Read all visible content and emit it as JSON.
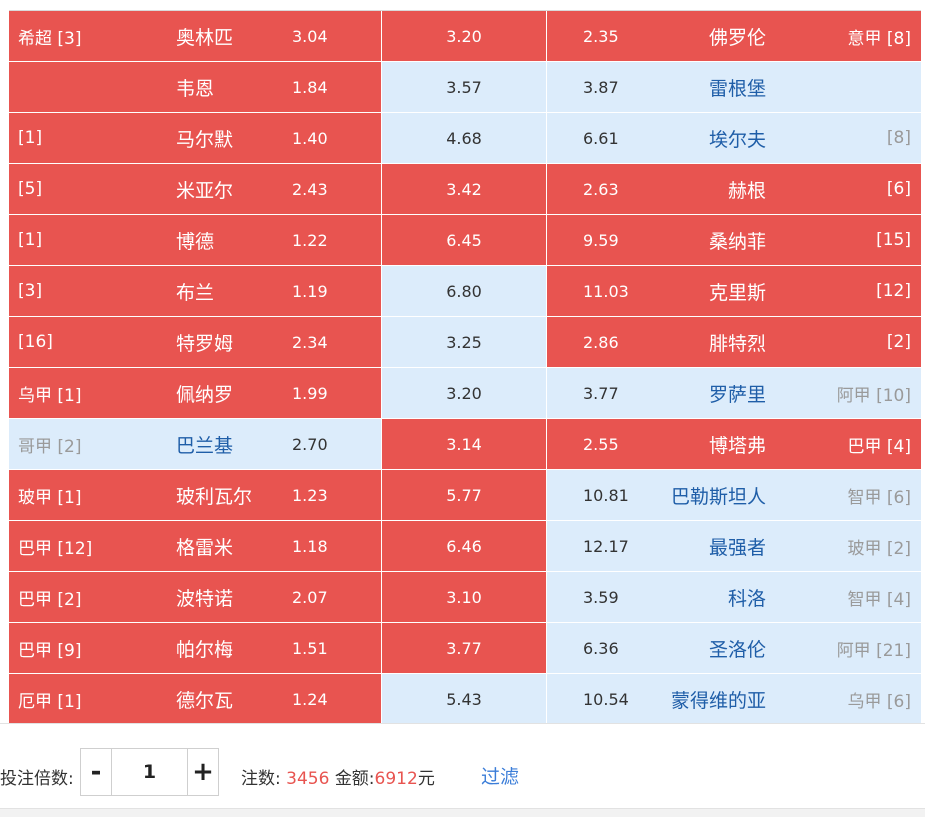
{
  "matches": [
    {
      "home_league": "希超 [3]",
      "home": "奥林匹",
      "home_odds": "3.04",
      "draw_odds": "3.20",
      "away_odds": "2.35",
      "away": "佛罗伦",
      "away_rank": "意甲 [8]",
      "sel": [
        "red",
        "red",
        "red"
      ]
    },
    {
      "home_league": "",
      "home": "韦恩",
      "home_odds": "1.84",
      "draw_odds": "3.57",
      "away_odds": "3.87",
      "away": "雷根堡",
      "away_rank": "",
      "sel": [
        "red",
        "blue",
        "blue"
      ]
    },
    {
      "home_league": "[1]",
      "home": "马尔默",
      "home_odds": "1.40",
      "draw_odds": "4.68",
      "away_odds": "6.61",
      "away": "埃尔夫",
      "away_rank": "[8]",
      "sel": [
        "red",
        "blue",
        "blue"
      ]
    },
    {
      "home_league": "[5]",
      "home": "米亚尔",
      "home_odds": "2.43",
      "draw_odds": "3.42",
      "away_odds": "2.63",
      "away": "赫根",
      "away_rank": "[6]",
      "sel": [
        "red",
        "red",
        "red"
      ]
    },
    {
      "home_league": "[1]",
      "home": "博德",
      "home_odds": "1.22",
      "draw_odds": "6.45",
      "away_odds": "9.59",
      "away": "桑纳菲",
      "away_rank": "[15]",
      "sel": [
        "red",
        "red",
        "red"
      ]
    },
    {
      "home_league": "[3]",
      "home": "布兰",
      "home_odds": "1.19",
      "draw_odds": "6.80",
      "away_odds": "11.03",
      "away": "克里斯",
      "away_rank": "[12]",
      "sel": [
        "red",
        "blue",
        "red"
      ]
    },
    {
      "home_league": "[16]",
      "home": "特罗姆",
      "home_odds": "2.34",
      "draw_odds": "3.25",
      "away_odds": "2.86",
      "away": "腓特烈",
      "away_rank": "[2]",
      "sel": [
        "red",
        "blue",
        "red"
      ]
    },
    {
      "home_league": "乌甲 [1]",
      "home": "佩纳罗",
      "home_odds": "1.99",
      "draw_odds": "3.20",
      "away_odds": "3.77",
      "away": "罗萨里",
      "away_rank": "阿甲 [10]",
      "sel": [
        "red",
        "blue",
        "blue"
      ]
    },
    {
      "home_league": "哥甲 [2]",
      "home": "巴兰基",
      "home_odds": "2.70",
      "draw_odds": "3.14",
      "away_odds": "2.55",
      "away": "博塔弗",
      "away_rank": "巴甲 [4]",
      "sel": [
        "blue",
        "red",
        "red"
      ]
    },
    {
      "home_league": "玻甲 [1]",
      "home": "玻利瓦尔",
      "home_odds": "1.23",
      "draw_odds": "5.77",
      "away_odds": "10.81",
      "away": "巴勒斯坦人",
      "away_rank": "智甲 [6]",
      "sel": [
        "red",
        "red",
        "blue"
      ]
    },
    {
      "home_league": "巴甲 [12]",
      "home": "格雷米",
      "home_odds": "1.18",
      "draw_odds": "6.46",
      "away_odds": "12.17",
      "away": "最强者",
      "away_rank": "玻甲 [2]",
      "sel": [
        "red",
        "red",
        "blue"
      ]
    },
    {
      "home_league": "巴甲 [2]",
      "home": "波特诺",
      "home_odds": "2.07",
      "draw_odds": "3.10",
      "away_odds": "3.59",
      "away": "科洛",
      "away_rank": "智甲 [4]",
      "sel": [
        "red",
        "red",
        "blue"
      ]
    },
    {
      "home_league": "巴甲 [9]",
      "home": "帕尔梅",
      "home_odds": "1.51",
      "draw_odds": "3.77",
      "away_odds": "6.36",
      "away": "圣洛伦",
      "away_rank": "阿甲 [21]",
      "sel": [
        "red",
        "red",
        "blue"
      ]
    },
    {
      "home_league": "厄甲 [1]",
      "home": "德尔瓦",
      "home_odds": "1.24",
      "draw_odds": "5.43",
      "away_odds": "10.54",
      "away": "蒙得维的亚",
      "away_rank": "乌甲 [6]",
      "sel": [
        "red",
        "blue",
        "blue"
      ]
    }
  ],
  "footer": {
    "multiplier_label": "投注倍数:",
    "minus": "-",
    "plus": "+",
    "multiplier_value": "1",
    "count_label": "注数:",
    "count_value": "3456",
    "amount_label": "金额:",
    "amount_value": "6912",
    "amount_unit": "元",
    "filter_label": "过滤"
  },
  "colors": {
    "selected": "#e85450",
    "unselected": "#dcecfb",
    "link": "#3b7dd8"
  }
}
